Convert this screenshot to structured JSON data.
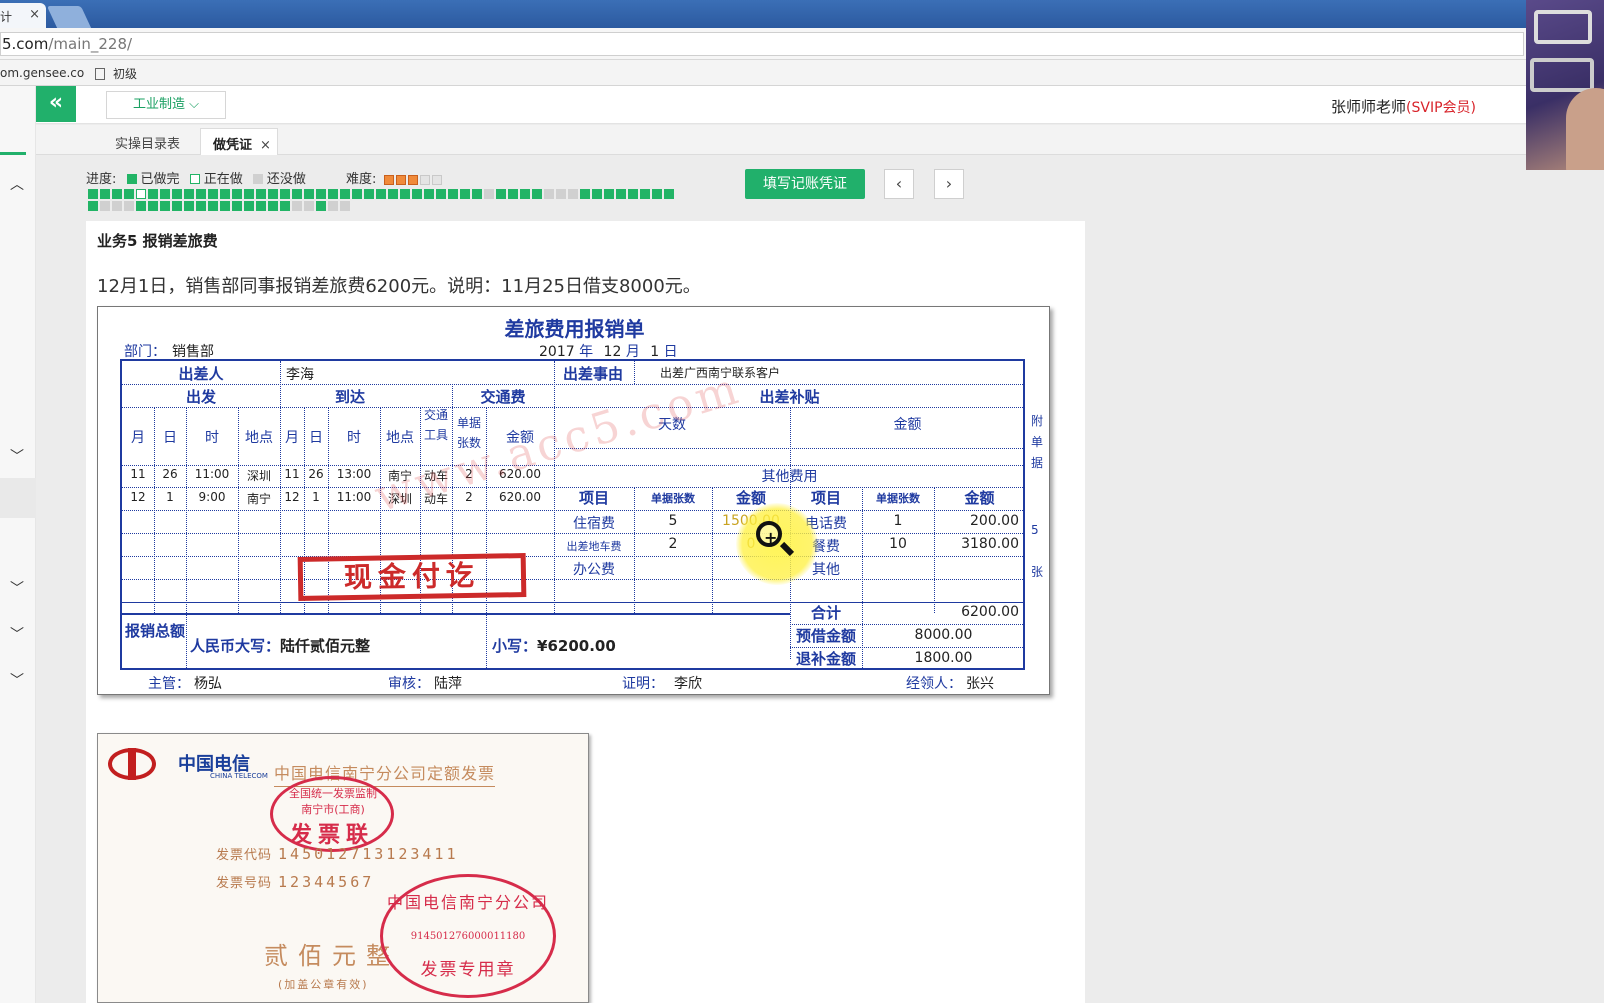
{
  "browser": {
    "tab_label": "计",
    "tab_close": "×",
    "url_host": "5.com",
    "url_path": "/main_228/",
    "bookmark1": "om.gensee.co",
    "bookmark2": "初级"
  },
  "header": {
    "collapse_icon": "«",
    "industry": "工业制造",
    "industry_chevron": "⌵",
    "user_name": "张师师老师",
    "user_level": "(SVIP会员)"
  },
  "tabs": [
    {
      "label": "实操目录表"
    },
    {
      "label": "做凭证",
      "close": "×"
    }
  ],
  "progress": {
    "label": "进度:",
    "done": "已做完",
    "doing": "正在做",
    "todo": "还没做",
    "difficulty_label": "难度:",
    "difficulty_level": 3,
    "difficulty_max": 5
  },
  "toolbar": {
    "fill_button": "填写记账凭证",
    "prev": "‹",
    "next": "›"
  },
  "task": {
    "title": "业务5 报销差旅费",
    "description": "12月1日，销售部同事报销差旅费6200元。说明：11月25日借支8000元。"
  },
  "form": {
    "title": "差旅费用报销单",
    "dept_label": "部门：",
    "dept": "销售部",
    "date_year": "2017",
    "date_month": "12",
    "date_day": "1",
    "unit_year": "年",
    "unit_month": "月",
    "unit_day": "日",
    "traveler_label": "出差人",
    "traveler": "李海",
    "reason_label": "出差事由",
    "reason": "出差广西南宁联系客户",
    "depart_label": "出发",
    "arrive_label": "到达",
    "transport_fee_label": "交通费",
    "allowance_label": "出差补贴",
    "col_month": "月",
    "col_day": "日",
    "col_time": "时",
    "col_place": "地点",
    "col_vehicle": "交通工具",
    "col_receipts": "单据张数",
    "col_amount": "金额",
    "col_days": "天数",
    "other_fees_label": "其他费用",
    "col_item": "项目",
    "trips": [
      {
        "m": "11",
        "d": "26",
        "t": "11:00",
        "p": "深圳",
        "am": "11",
        "ad": "26",
        "at": "13:00",
        "ap": "南宁",
        "v": "动车",
        "n": "2",
        "amt": "620.00"
      },
      {
        "m": "12",
        "d": "1",
        "t": "9:00",
        "p": "南宁",
        "am": "12",
        "ad": "1",
        "at": "11:00",
        "ap": "深圳",
        "v": "动车",
        "n": "2",
        "amt": "620.00"
      }
    ],
    "fees_left": [
      {
        "item": "住宿费",
        "n": "5",
        "amt": "1500.00"
      },
      {
        "item": "出差地车费",
        "n": "2",
        "amt": "0"
      },
      {
        "item": "办公费",
        "n": "",
        "amt": ""
      }
    ],
    "fees_right": [
      {
        "item": "电话费",
        "n": "1",
        "amt": "200.00"
      },
      {
        "item": "餐费",
        "n": "10",
        "amt": "3180.00"
      },
      {
        "item": "其他",
        "n": "",
        "amt": ""
      }
    ],
    "total_label": "合计",
    "total": "6200.00",
    "reimburse_label": "报销总额",
    "rmb_upper_label": "人民币大写：",
    "rmb_upper": "陆仟贰佰元整",
    "small_label": "小写：",
    "small": "¥6200.00",
    "advance_label": "预借金额",
    "advance": "8000.00",
    "refund_label": "退补金额",
    "refund": "1800.00",
    "attach_label": "附单据",
    "attach_count": "5",
    "attach_unit": "张",
    "manager_label": "主管：",
    "manager": "杨弘",
    "audit_label": "审核：",
    "audit": "陆萍",
    "proof_label": "证明：",
    "proof": "李欣",
    "handler_label": "经领人：",
    "handler": "张兴",
    "cash_stamp": "现金付讫",
    "watermark": "www.acc5.com"
  },
  "invoice": {
    "logo": "中国电信",
    "logo_sub": "CHINA TELECOM",
    "title": "中国电信南宁分公司定额发票",
    "seal1_line1": "全国统一发票监制",
    "seal1_line2": "南宁市(工商)",
    "seal1_big": "发票联",
    "code_label": "发票代码",
    "code": "145012713123411",
    "num_label": "发票号码",
    "num": "12344567",
    "amount": "贰佰元整",
    "note": "(加盖公章有效)",
    "seal2_line1": "中国电信南宁分公司",
    "seal2_code": "914501276000011180",
    "seal2_line2": "发票专用章"
  }
}
